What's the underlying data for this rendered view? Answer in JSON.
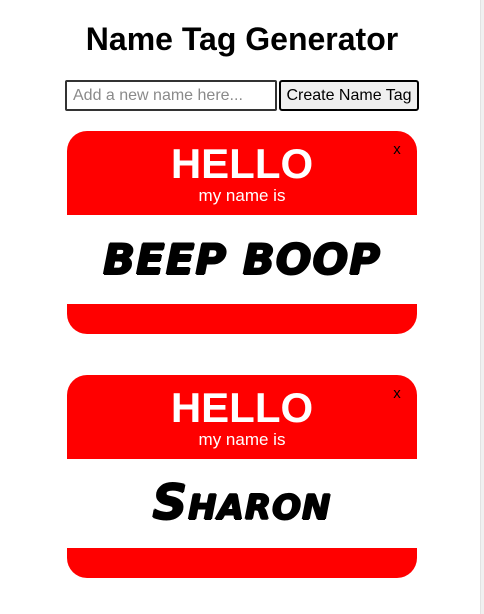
{
  "app": {
    "title": "Name Tag Generator"
  },
  "form": {
    "input_value": "",
    "input_placeholder": "Add a new name here...",
    "create_label": "Create Name Tag"
  },
  "tags": [
    {
      "hello": "HELLO",
      "subtitle": "my name is",
      "name": "Beep Boop",
      "close_label": "x"
    },
    {
      "hello": "HELLO",
      "subtitle": "my name is",
      "name": "Sharon",
      "close_label": "x"
    }
  ],
  "colors": {
    "tag_red": "#ff0000",
    "tag_text": "#ffffff",
    "name_text": "#000000"
  }
}
